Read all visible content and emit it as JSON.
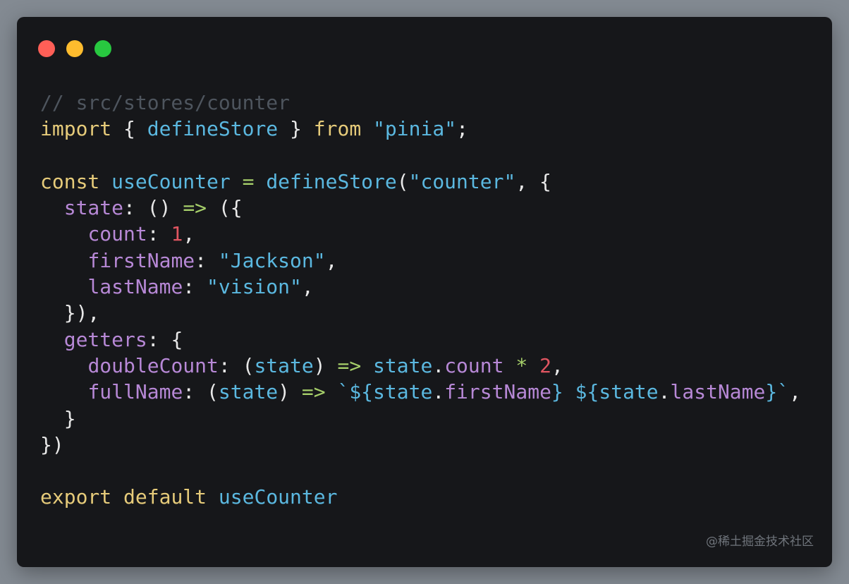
{
  "window": {
    "buttons": [
      {
        "name": "close",
        "color": "#ff5f57"
      },
      {
        "name": "minimize",
        "color": "#febc2e"
      },
      {
        "name": "zoom",
        "color": "#28c840"
      }
    ]
  },
  "code": {
    "lines": [
      [
        {
          "t": "// src/stores/counter",
          "k": "comment"
        }
      ],
      [
        {
          "t": "import",
          "k": "keyword"
        },
        {
          "t": " { ",
          "k": "punct"
        },
        {
          "t": "defineStore",
          "k": "ident"
        },
        {
          "t": " } ",
          "k": "punct"
        },
        {
          "t": "from",
          "k": "keyword"
        },
        {
          "t": " ",
          "k": "punct"
        },
        {
          "t": "\"pinia\"",
          "k": "string"
        },
        {
          "t": ";",
          "k": "punct"
        }
      ],
      [],
      [
        {
          "t": "const",
          "k": "keyword"
        },
        {
          "t": " ",
          "k": "punct"
        },
        {
          "t": "useCounter",
          "k": "ident"
        },
        {
          "t": " ",
          "k": "punct"
        },
        {
          "t": "=",
          "k": "op"
        },
        {
          "t": " ",
          "k": "punct"
        },
        {
          "t": "defineStore",
          "k": "ident"
        },
        {
          "t": "(",
          "k": "punct"
        },
        {
          "t": "\"counter\"",
          "k": "string"
        },
        {
          "t": ", {",
          "k": "punct"
        }
      ],
      [
        {
          "t": "  ",
          "k": "punct"
        },
        {
          "t": "state",
          "k": "prop"
        },
        {
          "t": ": () ",
          "k": "punct"
        },
        {
          "t": "=>",
          "k": "arrow"
        },
        {
          "t": " ({",
          "k": "punct"
        }
      ],
      [
        {
          "t": "    ",
          "k": "punct"
        },
        {
          "t": "count",
          "k": "prop"
        },
        {
          "t": ": ",
          "k": "punct"
        },
        {
          "t": "1",
          "k": "number"
        },
        {
          "t": ",",
          "k": "punct"
        }
      ],
      [
        {
          "t": "    ",
          "k": "punct"
        },
        {
          "t": "firstName",
          "k": "prop"
        },
        {
          "t": ": ",
          "k": "punct"
        },
        {
          "t": "\"Jackson\"",
          "k": "string"
        },
        {
          "t": ",",
          "k": "punct"
        }
      ],
      [
        {
          "t": "    ",
          "k": "punct"
        },
        {
          "t": "lastName",
          "k": "prop"
        },
        {
          "t": ": ",
          "k": "punct"
        },
        {
          "t": "\"vision\"",
          "k": "string"
        },
        {
          "t": ",",
          "k": "punct"
        }
      ],
      [
        {
          "t": "  }),",
          "k": "punct"
        }
      ],
      [
        {
          "t": "  ",
          "k": "punct"
        },
        {
          "t": "getters",
          "k": "prop"
        },
        {
          "t": ": {",
          "k": "punct"
        }
      ],
      [
        {
          "t": "    ",
          "k": "punct"
        },
        {
          "t": "doubleCount",
          "k": "prop"
        },
        {
          "t": ": (",
          "k": "punct"
        },
        {
          "t": "state",
          "k": "ident"
        },
        {
          "t": ") ",
          "k": "punct"
        },
        {
          "t": "=>",
          "k": "arrow"
        },
        {
          "t": " ",
          "k": "punct"
        },
        {
          "t": "state",
          "k": "ident"
        },
        {
          "t": ".",
          "k": "punct"
        },
        {
          "t": "count",
          "k": "prop"
        },
        {
          "t": " ",
          "k": "punct"
        },
        {
          "t": "*",
          "k": "op"
        },
        {
          "t": " ",
          "k": "punct"
        },
        {
          "t": "2",
          "k": "number"
        },
        {
          "t": ",",
          "k": "punct"
        }
      ],
      [
        {
          "t": "    ",
          "k": "punct"
        },
        {
          "t": "fullName",
          "k": "prop"
        },
        {
          "t": ": (",
          "k": "punct"
        },
        {
          "t": "state",
          "k": "ident"
        },
        {
          "t": ") ",
          "k": "punct"
        },
        {
          "t": "=>",
          "k": "arrow"
        },
        {
          "t": " ",
          "k": "punct"
        },
        {
          "t": "`${",
          "k": "string"
        },
        {
          "t": "state",
          "k": "ident"
        },
        {
          "t": ".",
          "k": "punct"
        },
        {
          "t": "firstName",
          "k": "prop"
        },
        {
          "t": "}",
          "k": "string"
        },
        {
          "t": " ",
          "k": "punct"
        },
        {
          "t": "${",
          "k": "string"
        },
        {
          "t": "state",
          "k": "ident"
        },
        {
          "t": ".",
          "k": "punct"
        },
        {
          "t": "lastName",
          "k": "prop"
        },
        {
          "t": "}`",
          "k": "string"
        },
        {
          "t": ",",
          "k": "punct"
        }
      ],
      [
        {
          "t": "  }",
          "k": "punct"
        }
      ],
      [
        {
          "t": "})",
          "k": "punct"
        }
      ],
      [],
      [
        {
          "t": "export",
          "k": "keyword"
        },
        {
          "t": " ",
          "k": "punct"
        },
        {
          "t": "default",
          "k": "keyword"
        },
        {
          "t": " ",
          "k": "punct"
        },
        {
          "t": "useCounter",
          "k": "ident"
        }
      ]
    ]
  },
  "watermark": "@稀土掘金技术社区"
}
